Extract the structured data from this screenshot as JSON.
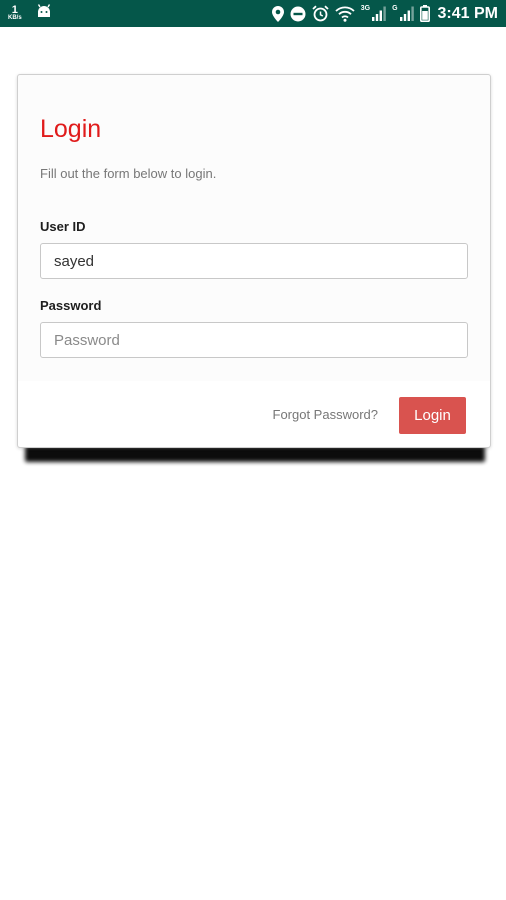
{
  "status_bar": {
    "net_speed_value": "1",
    "net_speed_unit": "KB/s",
    "network_3g": "3G",
    "network_label_2": "G",
    "time": "3:41 PM",
    "icons": [
      "android-icon",
      "location-icon",
      "dnd-icon",
      "alarm-icon",
      "wifi-icon",
      "signal-icon",
      "signal-icon",
      "battery-icon"
    ],
    "background": "#05574a"
  },
  "login_form": {
    "title": "Login",
    "subtitle": "Fill out the form below to login.",
    "user_id_label": "User ID",
    "user_id_value": "sayed",
    "password_label": "Password",
    "password_placeholder": "Password",
    "forgot_password": "Forgot Password?",
    "login_button": "Login",
    "title_color": "#e01b1b",
    "button_color": "#d9534f"
  }
}
